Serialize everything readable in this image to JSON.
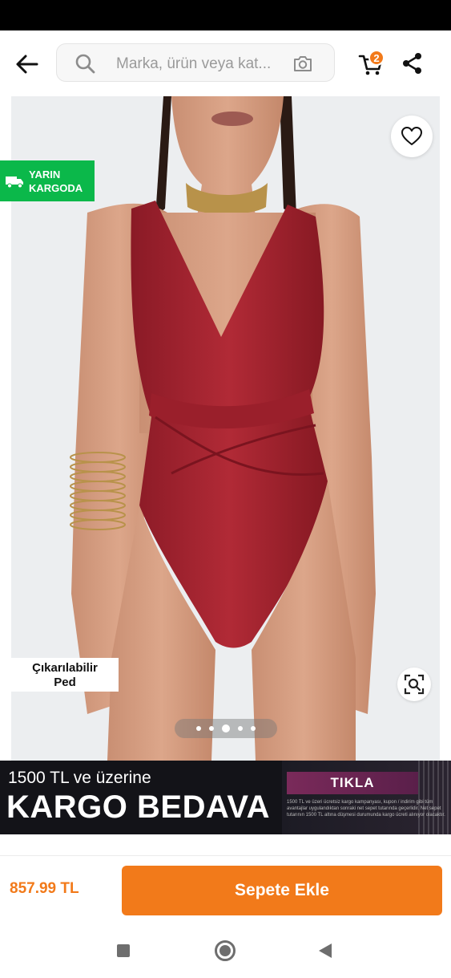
{
  "header": {
    "search_placeholder": "Marka, ürün veya kat...",
    "cart_count": "2"
  },
  "product": {
    "shipping_badge_line1": "YARIN",
    "shipping_badge_line2": "KARGODA",
    "feature_tag_line1": "Çıkarılabilir",
    "feature_tag_line2": "Ped",
    "image_dots": 5,
    "active_dot_index": 2
  },
  "banner": {
    "line1": "1500 TL ve üzerine",
    "line2": "KARGO BEDAVA",
    "cta": "TIKLA",
    "fine_print": "1500 TL ve üzeri ücretsiz kargo kampanyası, kupon / indirim gibi tüm avantajlar uygulandıktan sonraki net sepet tutarında geçerlidir. Net sepet tutarının 1500 TL altına düşmesi durumunda kargo ücreti alınıyor olacaktır."
  },
  "purchase": {
    "price": "857.99 TL",
    "add_to_cart_label": "Sepete Ekle"
  },
  "colors": {
    "brand_orange": "#f27a1a",
    "badge_green": "#0bb84a",
    "product_red": "#a4222e"
  },
  "icons": [
    "back-arrow-icon",
    "search-icon",
    "camera-icon",
    "cart-icon",
    "share-icon",
    "heart-icon",
    "truck-icon",
    "visual-search-icon"
  ]
}
